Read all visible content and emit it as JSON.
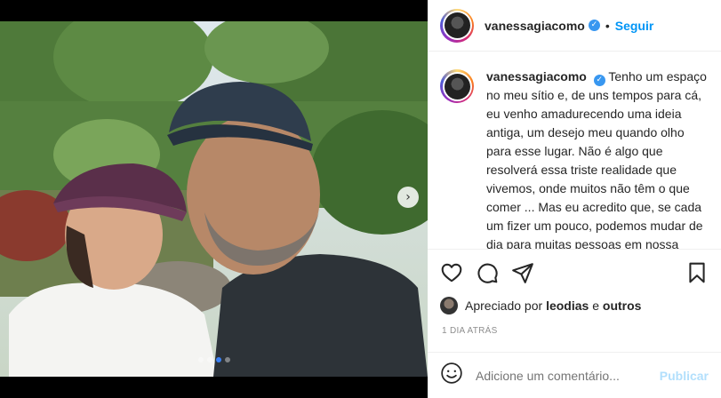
{
  "post": {
    "username": "vanessagiacomo",
    "separator": "•",
    "follow_label": "Seguir",
    "verified_icon": "✓",
    "caption": "Tenho um espaço no meu sítio e, de uns tempos para cá, eu venho amadurecendo uma ideia antiga, um desejo meu quando olho para esse lugar. Não é algo que resolverá essa triste realidade que vivemos, onde muitos não têm o que comer ... Mas eu acredito que, se cada um fizer um pouco, podemos mudar de dia para muitas pessoas em nossa comunidade, pessoas que estão em nossa volta. Estou",
    "carousel": {
      "dot_count": 4,
      "active_index": 2,
      "next_icon": "›"
    },
    "likes": {
      "prefix": "Apreciado por",
      "user": "leodias",
      "conjunction": "e",
      "others": "outros"
    },
    "time_ago": "1 DIA ATRÁS",
    "comment": {
      "placeholder": "Adicione um comentário...",
      "publish_label": "Publicar"
    },
    "icons": {
      "like": "heart-icon",
      "comment": "comment-icon",
      "share": "share-icon",
      "save": "bookmark-icon",
      "emoji": "emoji-icon"
    },
    "colors": {
      "accent": "#0095f6",
      "verified": "#3897f0",
      "publish_disabled": "#b2dffc",
      "muted": "#8e8e8e"
    }
  }
}
